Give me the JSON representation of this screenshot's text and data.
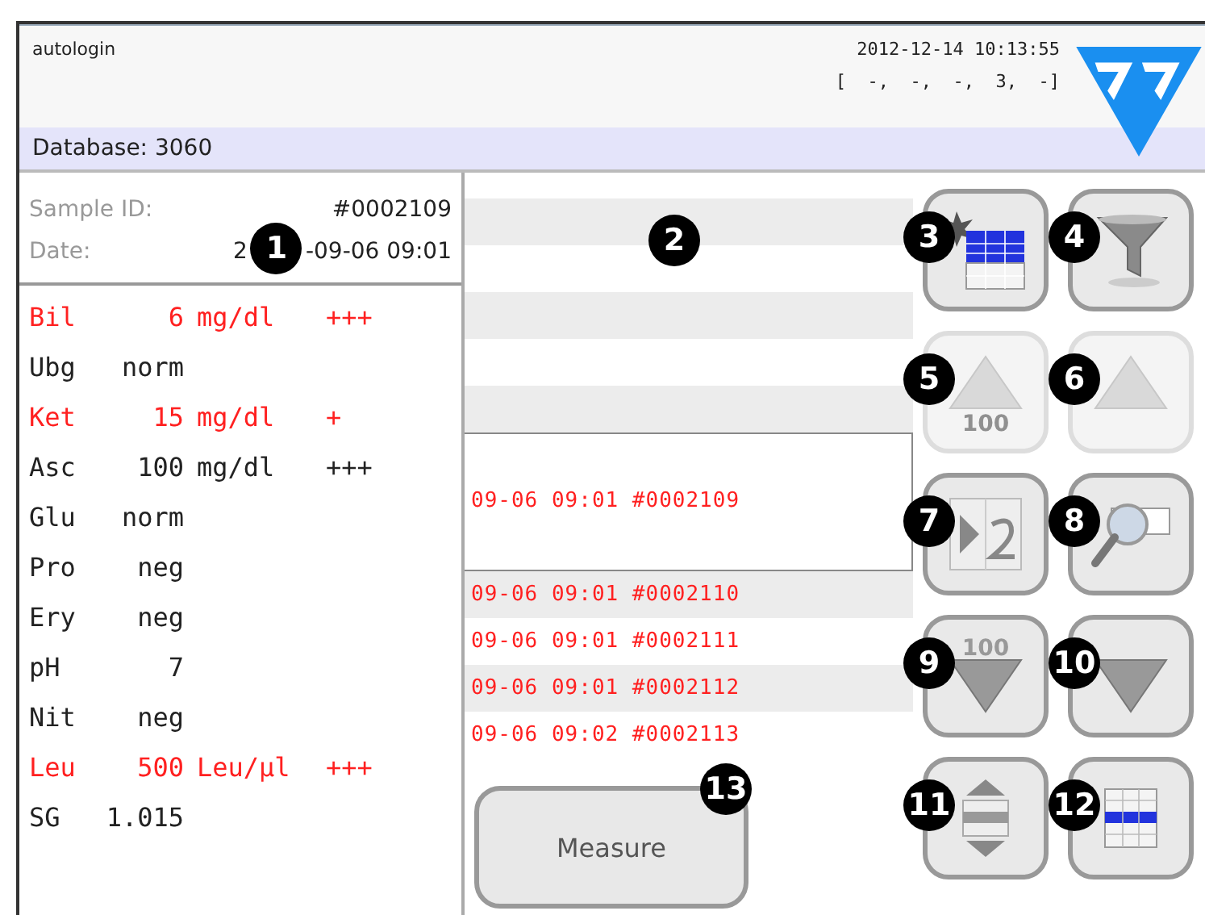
{
  "header": {
    "user": "autologin",
    "datetime": "2012-12-14 10:13:55",
    "status": "[  -,  -,  -,  3,  -]"
  },
  "database_bar": {
    "label": "Database: 3060"
  },
  "sample": {
    "id_label": "Sample ID:",
    "id_value": "#0002109",
    "date_label": "Date:",
    "date_value_start": "2",
    "date_value_end": "-09-06 09:01",
    "callout": "1"
  },
  "results": [
    {
      "name": "Bil",
      "value": "6",
      "unit": "mg/dl",
      "flag": "+++",
      "abnormal": true
    },
    {
      "name": "Ubg",
      "value": "norm",
      "abnormal": false
    },
    {
      "name": "Ket",
      "value": "15",
      "unit": "mg/dl",
      "flag": "+",
      "abnormal": true
    },
    {
      "name": "Asc",
      "value": "100",
      "unit": "mg/dl",
      "flag": "+++",
      "abnormal": false
    },
    {
      "name": "Glu",
      "value": "norm",
      "abnormal": false
    },
    {
      "name": "Pro",
      "value": "neg",
      "abnormal": false
    },
    {
      "name": "Ery",
      "value": "neg",
      "abnormal": false
    },
    {
      "name": "pH",
      "value": "7",
      "abnormal": false
    },
    {
      "name": "Nit",
      "value": "neg",
      "abnormal": false
    },
    {
      "name": "Leu",
      "value": "500",
      "unit": "Leu/µl",
      "flag": "+++",
      "abnormal": true
    },
    {
      "name": "SG",
      "value": "1.015",
      "abnormal": false
    }
  ],
  "records": {
    "callout": "2",
    "items": [
      {
        "text": "09-06 09:01 #0002109",
        "selected": true
      },
      {
        "text": "09-06 09:01 #0002110",
        "selected": false
      },
      {
        "text": "09-06 09:01 #0002111",
        "selected": false
      },
      {
        "text": "09-06 09:01 #0002112",
        "selected": false
      },
      {
        "text": "09-06 09:02 #0002113",
        "selected": false
      }
    ]
  },
  "measure_button": {
    "label": "Measure",
    "callout": "13"
  },
  "buttons": [
    {
      "kind": "new-table",
      "callout": "3",
      "disabled": false
    },
    {
      "kind": "filter",
      "callout": "4",
      "disabled": false
    },
    {
      "kind": "up-100",
      "callout": "5",
      "label": "100",
      "disabled": true
    },
    {
      "kind": "up",
      "callout": "6",
      "disabled": true
    },
    {
      "kind": "page",
      "callout": "7",
      "disabled": false
    },
    {
      "kind": "search",
      "callout": "8",
      "disabled": false
    },
    {
      "kind": "down-100",
      "callout": "9",
      "label": "100",
      "disabled": false
    },
    {
      "kind": "down",
      "callout": "10",
      "disabled": false
    },
    {
      "kind": "scroll-table",
      "callout": "11",
      "disabled": false
    },
    {
      "kind": "select-table",
      "callout": "12",
      "disabled": false
    }
  ]
}
